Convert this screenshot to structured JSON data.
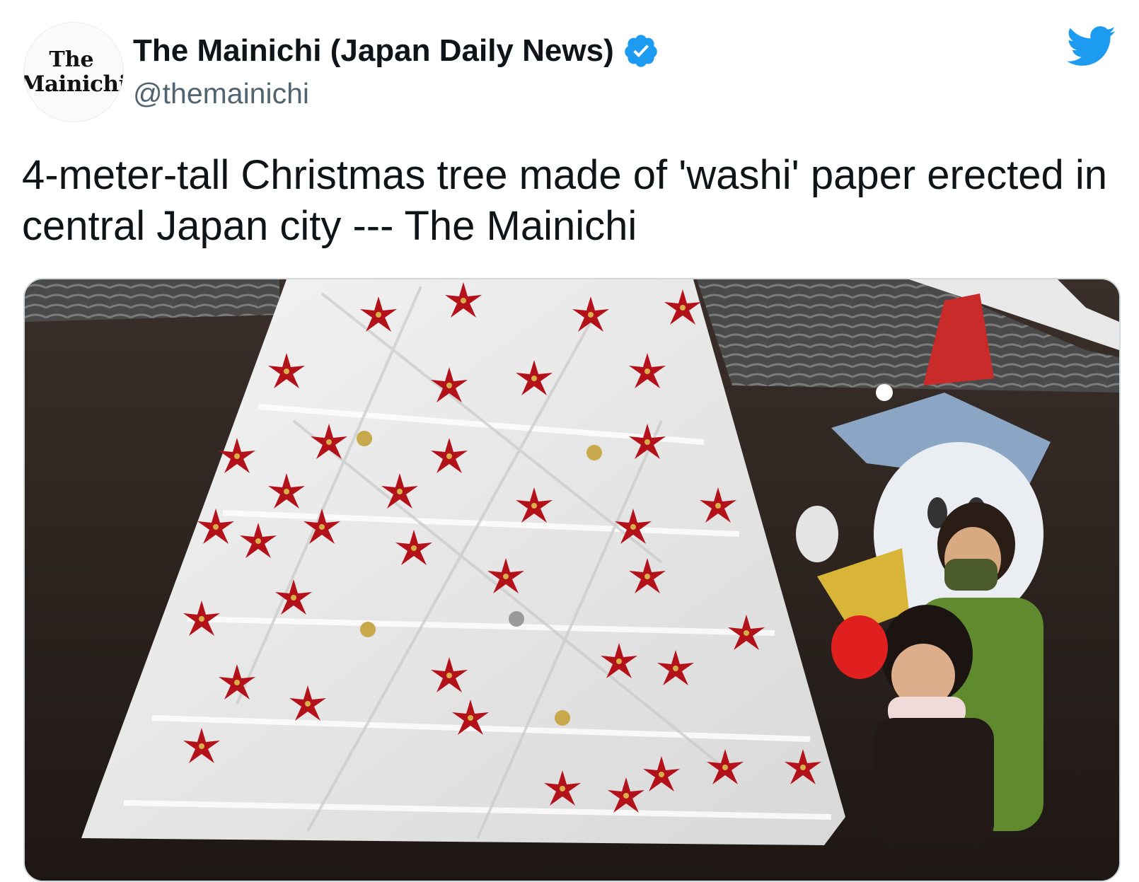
{
  "account": {
    "display_name": "The Mainichi (Japan Daily News)",
    "handle": "@themainichi",
    "verified": true,
    "avatar_text_line1": "The",
    "avatar_text_line2": "Mainichi"
  },
  "tweet": {
    "text": "4-meter-tall Christmas tree made of 'washi' paper erected in central Japan city --- The Mainichi"
  },
  "icons": {
    "verified": "verified-badge-icon",
    "brand": "twitter-bird-icon"
  },
  "colors": {
    "verified_blue": "#1d9bf0",
    "twitter_blue": "#1d9bf0",
    "handle_gray": "#536471",
    "card_border": "#cfd9de"
  }
}
